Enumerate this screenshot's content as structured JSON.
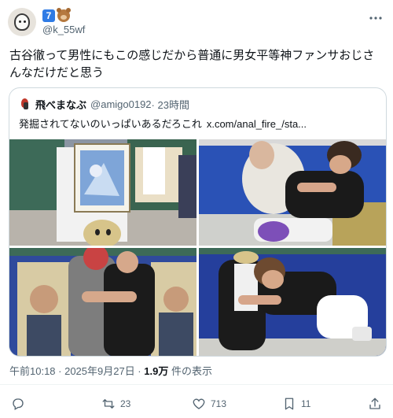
{
  "tweet": {
    "author_handle": "@k_55wf",
    "badge_number": "7",
    "text": "古谷徹って男性にもこの感じだから普通に男女平等神ファンサおじさんなだけだと思う",
    "timestamp": "午前10:18 · 2025年9月27日 · ",
    "views_count": "1.9万",
    "views_label": " 件の表示"
  },
  "quote": {
    "author_name": "飛べまなぶ",
    "author_handle": "@amigo0192",
    "time": " · 23時間",
    "text": "発掘されてないのいっぱいあるだろこれ",
    "link": "x.com/anal_fire_/sta..."
  },
  "actions": {
    "reply_count": "",
    "retweet_count": "23",
    "like_count": "713",
    "bookmark_count": "11"
  },
  "icons": [
    "more-icon",
    "reply-icon",
    "retweet-icon",
    "like-icon",
    "bookmark-icon",
    "share-icon"
  ],
  "colors": {
    "text": "#0f1419",
    "muted": "#536471",
    "border": "#cfd9de",
    "badge": "#2f7be5"
  }
}
